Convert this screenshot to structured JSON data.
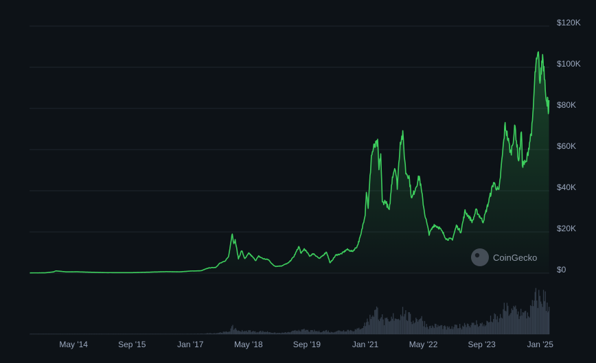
{
  "watermark": "CoinGecko",
  "colors": {
    "background": "#0d1217",
    "line": "#3ecf5e",
    "grid": "#1e252d",
    "volume": "#3a4452",
    "axis_text": "#9aa7bd"
  },
  "chart_data": {
    "type": "area",
    "title": "",
    "xlabel": "",
    "ylabel": "",
    "ylim": [
      0,
      120000
    ],
    "y_ticks": [
      {
        "value": 0,
        "label": "$0"
      },
      {
        "value": 20000,
        "label": "$20K"
      },
      {
        "value": 40000,
        "label": "$40K"
      },
      {
        "value": 60000,
        "label": "$60K"
      },
      {
        "value": 80000,
        "label": "$80K"
      },
      {
        "value": 100000,
        "label": "$100K"
      },
      {
        "value": 120000,
        "label": "$120K"
      }
    ],
    "x_ticks": [
      {
        "date": "2014-05-01",
        "label": "May '14"
      },
      {
        "date": "2015-09-01",
        "label": "Sep '15"
      },
      {
        "date": "2017-01-01",
        "label": "Jan '17"
      },
      {
        "date": "2018-05-01",
        "label": "May '18"
      },
      {
        "date": "2019-09-01",
        "label": "Sep '19"
      },
      {
        "date": "2021-01-01",
        "label": "Jan '21"
      },
      {
        "date": "2022-05-01",
        "label": "May '22"
      },
      {
        "date": "2023-09-01",
        "label": "Sep '23"
      },
      {
        "date": "2025-01-01",
        "label": "Jan '25"
      }
    ],
    "grid": true,
    "legend": "none",
    "series": [
      {
        "points": [
          [
            "2013-05-01",
            120
          ],
          [
            "2013-09-01",
            130
          ],
          [
            "2013-11-15",
            600
          ],
          [
            "2013-12-05",
            1100
          ],
          [
            "2014-01-15",
            850
          ],
          [
            "2014-03-01",
            600
          ],
          [
            "2014-06-01",
            640
          ],
          [
            "2014-09-01",
            450
          ],
          [
            "2015-01-15",
            250
          ],
          [
            "2015-06-01",
            230
          ],
          [
            "2015-09-01",
            235
          ],
          [
            "2016-01-01",
            430
          ],
          [
            "2016-06-15",
            700
          ],
          [
            "2016-10-01",
            610
          ],
          [
            "2017-01-01",
            1000
          ],
          [
            "2017-04-01",
            1150
          ],
          [
            "2017-06-01",
            2500
          ],
          [
            "2017-08-01",
            2800
          ],
          [
            "2017-09-01",
            4700
          ],
          [
            "2017-10-15",
            5700
          ],
          [
            "2017-11-15",
            8000
          ],
          [
            "2017-12-17",
            19500
          ],
          [
            "2017-12-30",
            14000
          ],
          [
            "2018-01-10",
            16000
          ],
          [
            "2018-02-06",
            7000
          ],
          [
            "2018-03-05",
            11000
          ],
          [
            "2018-04-01",
            6900
          ],
          [
            "2018-05-05",
            9700
          ],
          [
            "2018-06-30",
            6200
          ],
          [
            "2018-07-25",
            8200
          ],
          [
            "2018-09-01",
            7000
          ],
          [
            "2018-10-15",
            6500
          ],
          [
            "2018-11-25",
            3800
          ],
          [
            "2018-12-15",
            3300
          ],
          [
            "2019-02-01",
            3500
          ],
          [
            "2019-04-01",
            5000
          ],
          [
            "2019-05-15",
            8000
          ],
          [
            "2019-06-26",
            12900
          ],
          [
            "2019-07-15",
            9500
          ],
          [
            "2019-08-10",
            11800
          ],
          [
            "2019-09-25",
            8300
          ],
          [
            "2019-10-26",
            9500
          ],
          [
            "2019-12-15",
            7000
          ],
          [
            "2020-02-12",
            10300
          ],
          [
            "2020-03-13",
            4900
          ],
          [
            "2020-05-01",
            8800
          ],
          [
            "2020-06-15",
            9400
          ],
          [
            "2020-08-01",
            11500
          ],
          [
            "2020-09-15",
            10500
          ],
          [
            "2020-10-25",
            13000
          ],
          [
            "2020-11-25",
            18500
          ],
          [
            "2020-12-31",
            29000
          ],
          [
            "2021-01-10",
            40000
          ],
          [
            "2021-01-25",
            32000
          ],
          [
            "2021-02-21",
            57000
          ],
          [
            "2021-03-13",
            61000
          ],
          [
            "2021-04-14",
            63000
          ],
          [
            "2021-04-25",
            50000
          ],
          [
            "2021-05-10",
            58000
          ],
          [
            "2021-05-23",
            34000
          ],
          [
            "2021-06-20",
            35000
          ],
          [
            "2021-07-20",
            30000
          ],
          [
            "2021-08-15",
            47000
          ],
          [
            "2021-09-07",
            52000
          ],
          [
            "2021-09-25",
            42000
          ],
          [
            "2021-10-20",
            64000
          ],
          [
            "2021-11-10",
            67000
          ],
          [
            "2021-12-05",
            49000
          ],
          [
            "2022-01-01",
            47000
          ],
          [
            "2022-01-24",
            36000
          ],
          [
            "2022-03-28",
            47000
          ],
          [
            "2022-05-12",
            29000
          ],
          [
            "2022-06-18",
            19000
          ],
          [
            "2022-07-30",
            23500
          ],
          [
            "2022-09-12",
            22000
          ],
          [
            "2022-10-15",
            19200
          ],
          [
            "2022-11-10",
            16500
          ],
          [
            "2022-12-30",
            16500
          ],
          [
            "2023-02-01",
            23000
          ],
          [
            "2023-03-10",
            20000
          ],
          [
            "2023-04-14",
            30000
          ],
          [
            "2023-06-15",
            25000
          ],
          [
            "2023-07-15",
            30500
          ],
          [
            "2023-09-12",
            25000
          ],
          [
            "2023-10-25",
            34000
          ],
          [
            "2023-12-08",
            44000
          ],
          [
            "2024-01-22",
            39500
          ],
          [
            "2024-02-28",
            62000
          ],
          [
            "2024-03-14",
            72000
          ],
          [
            "2024-05-01",
            58000
          ],
          [
            "2024-06-05",
            71000
          ],
          [
            "2024-07-05",
            54000
          ],
          [
            "2024-07-28",
            69000
          ],
          [
            "2024-08-05",
            53000
          ],
          [
            "2024-09-06",
            53500
          ],
          [
            "2024-10-28",
            72000
          ],
          [
            "2024-11-12",
            89000
          ],
          [
            "2024-11-22",
            99000
          ],
          [
            "2024-12-17",
            106000
          ],
          [
            "2024-12-30",
            92000
          ],
          [
            "2025-01-21",
            106000
          ],
          [
            "2025-02-05",
            97000
          ],
          [
            "2025-02-28",
            80000
          ],
          [
            "2025-03-05",
            87000
          ],
          [
            "2025-03-10",
            78000
          ],
          [
            "2025-03-15",
            84000
          ]
        ]
      }
    ]
  }
}
